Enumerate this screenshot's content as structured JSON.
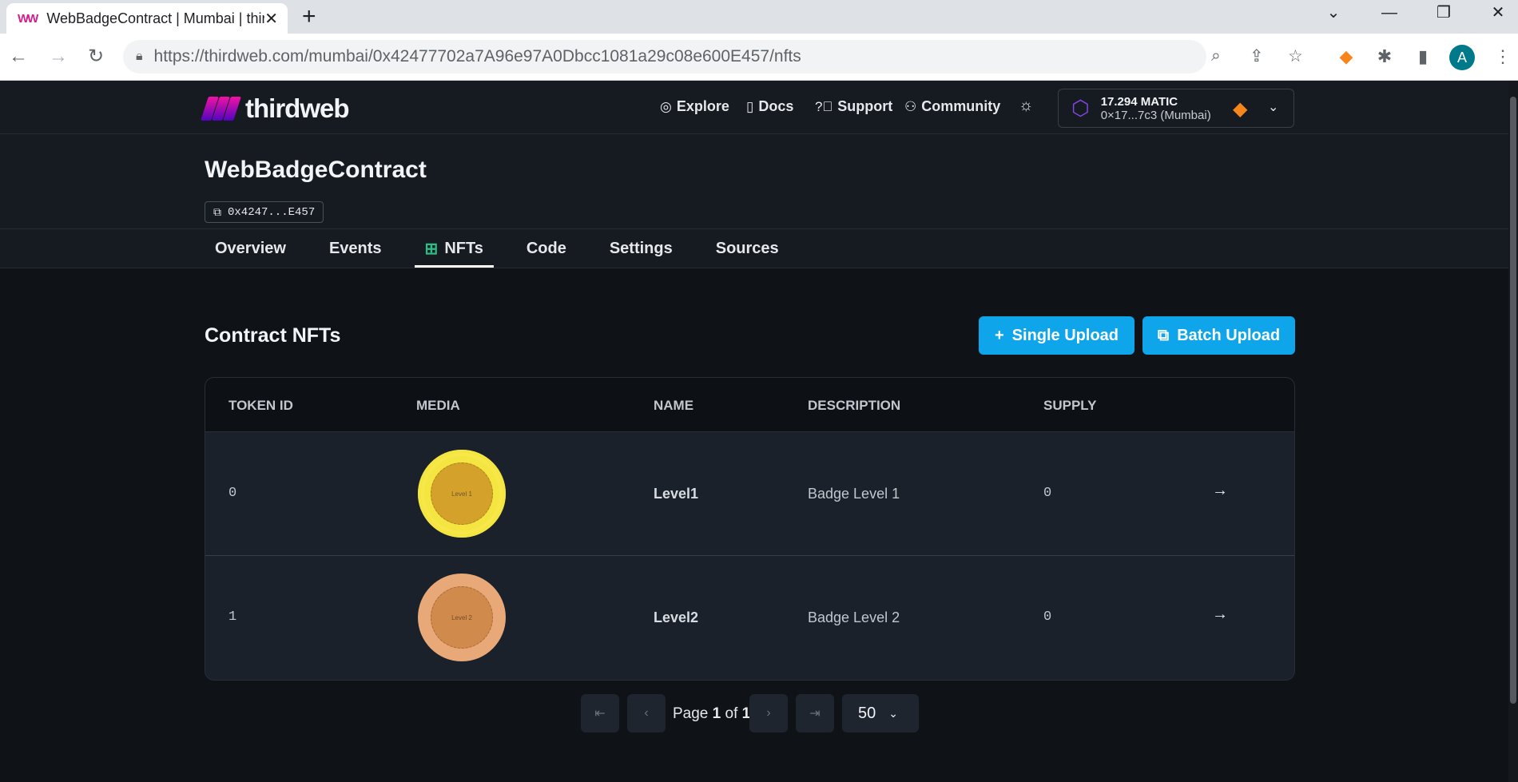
{
  "browser": {
    "tab_title": "WebBadgeContract | Mumbai | thirdweb",
    "url_host": "https://thirdweb.com",
    "url_path": "/mumbai/0x42477702a7A96e97A0Dbcc1081a29c08e600E457/nfts",
    "profile_initial": "A"
  },
  "header": {
    "logo_text": "thirdweb",
    "nav": [
      {
        "label": "Explore"
      },
      {
        "label": "Docs"
      },
      {
        "label": "Support"
      },
      {
        "label": "Community"
      }
    ],
    "wallet": {
      "balance": "17.294 MATIC",
      "address": "0×17...7c3 (Mumbai)"
    }
  },
  "contract": {
    "title": "WebBadgeContract",
    "address_short": "0x4247...E457"
  },
  "tabs": [
    {
      "label": "Overview"
    },
    {
      "label": "Events"
    },
    {
      "label": "NFTs"
    },
    {
      "label": "Code"
    },
    {
      "label": "Settings"
    },
    {
      "label": "Sources"
    }
  ],
  "section": {
    "title": "Contract NFTs",
    "single_upload": "Single Upload",
    "batch_upload": "Batch Upload"
  },
  "table": {
    "headers": [
      "TOKEN ID",
      "MEDIA",
      "NAME",
      "DESCRIPTION",
      "SUPPLY"
    ],
    "rows": [
      {
        "token_id": "0",
        "media_label": "Level 1",
        "name": "Level1",
        "description": "Badge Level 1",
        "supply": "0"
      },
      {
        "token_id": "1",
        "media_label": "Level 2",
        "name": "Level2",
        "description": "Badge Level 2",
        "supply": "0"
      }
    ]
  },
  "pagination": {
    "page_prefix": "Page",
    "current": "1",
    "of": "of",
    "total": "1",
    "page_size": "50"
  },
  "colors": {
    "accent": "#0ea5ea",
    "background": "#0f1318",
    "header": "#161b22"
  }
}
